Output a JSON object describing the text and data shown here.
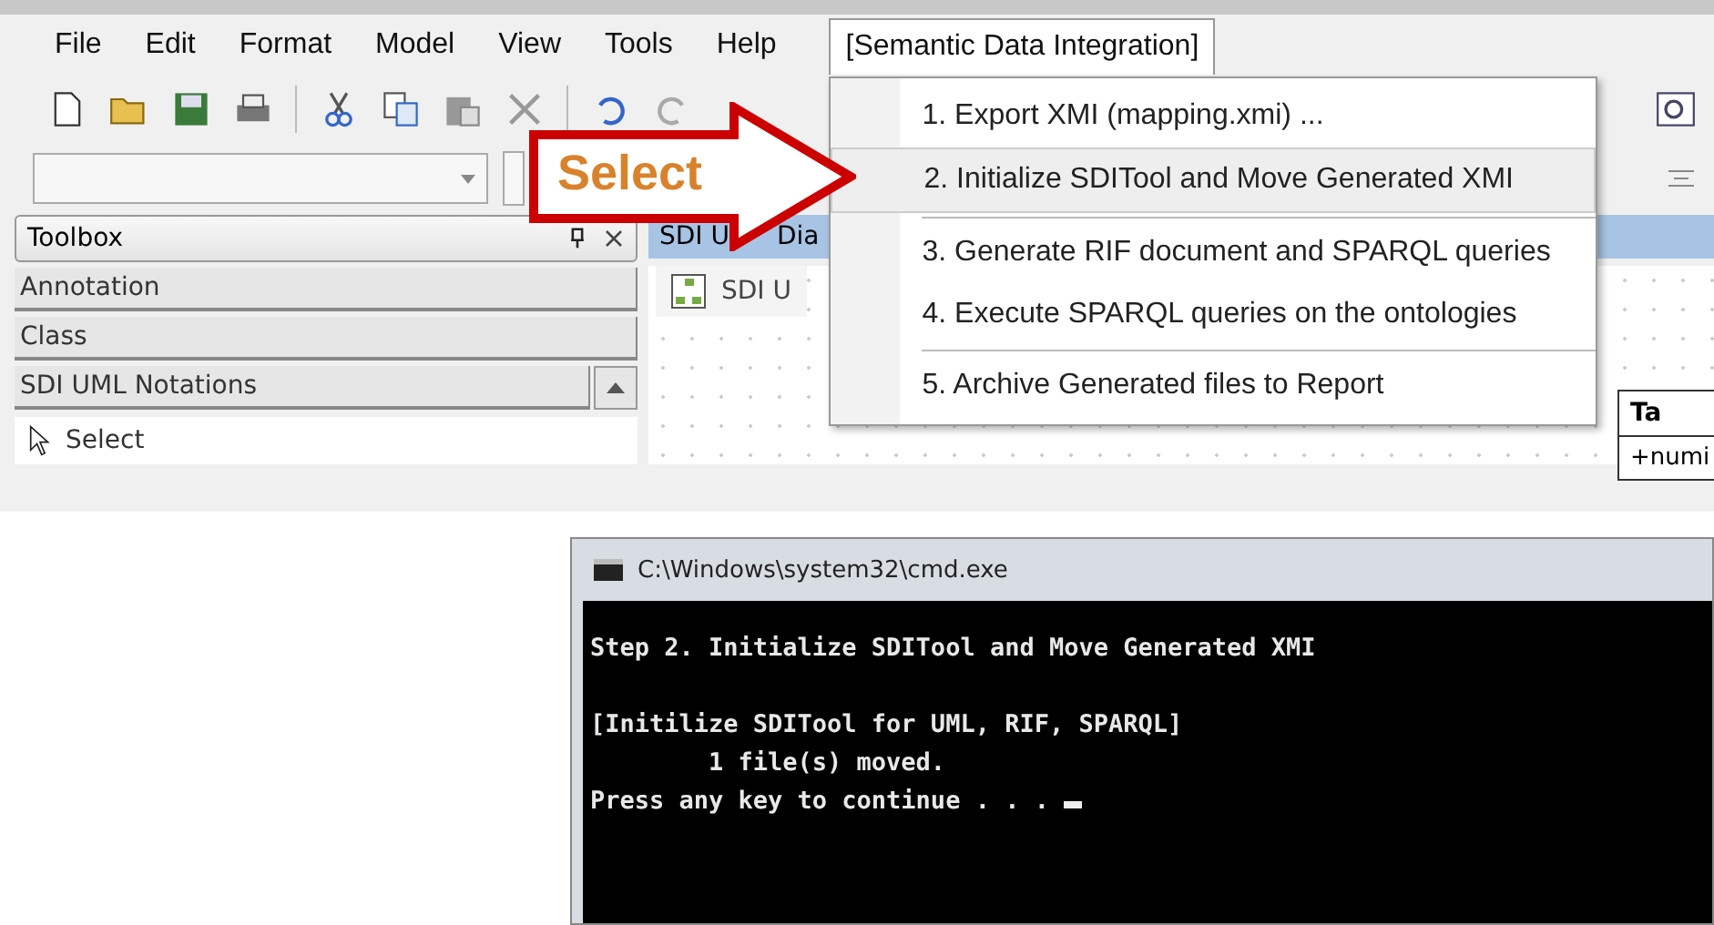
{
  "menubar": {
    "items": [
      {
        "label": "File",
        "selected": false
      },
      {
        "label": "Edit",
        "selected": false
      },
      {
        "label": "Format",
        "selected": false
      },
      {
        "label": "Model",
        "selected": false
      },
      {
        "label": "View",
        "selected": false
      },
      {
        "label": "Tools",
        "selected": false
      },
      {
        "label": "Help",
        "selected": false
      },
      {
        "label": "[Semantic Data Integration]",
        "selected": true
      }
    ]
  },
  "menu": {
    "items": [
      {
        "kind": "item",
        "label": "1. Export XMI (mapping.xmi) ...",
        "selected": false
      },
      {
        "kind": "item",
        "label": "2. Initialize SDITool and Move Generated XMI",
        "selected": true
      },
      {
        "kind": "separator"
      },
      {
        "kind": "item",
        "label": "3. Generate RIF document and SPARQL queries",
        "selected": false
      },
      {
        "kind": "item",
        "label": "4. Execute SPARQL queries on the ontologies",
        "selected": false
      },
      {
        "kind": "separator"
      },
      {
        "kind": "item",
        "label": "5. Archive Generated files to Report",
        "selected": false
      }
    ]
  },
  "callout": {
    "label": "Select"
  },
  "toolbox": {
    "title": "Toolbox",
    "sections": [
      {
        "label": "Annotation",
        "expanded": false
      },
      {
        "label": "Class",
        "expanded": false
      },
      {
        "label": "SDI UML Notations",
        "expanded": true
      }
    ],
    "tools": [
      {
        "label": "Select"
      }
    ]
  },
  "diagram": {
    "tab": [
      "SDI U",
      "Dia"
    ],
    "subtab": "SDI U",
    "class_title": "Ta",
    "class_attribute": "+numi"
  },
  "console": {
    "title": "C:\\Windows\\system32\\cmd.exe",
    "paragraphs": [
      [
        "Step 2. Initialize SDITool and Move Generated XMI"
      ],
      [
        "[Initilize SDITool for UML, RIF, SPARQL]",
        "        1 file(s) moved.",
        "Press any key to continue . . ."
      ]
    ],
    "cursor": true
  }
}
